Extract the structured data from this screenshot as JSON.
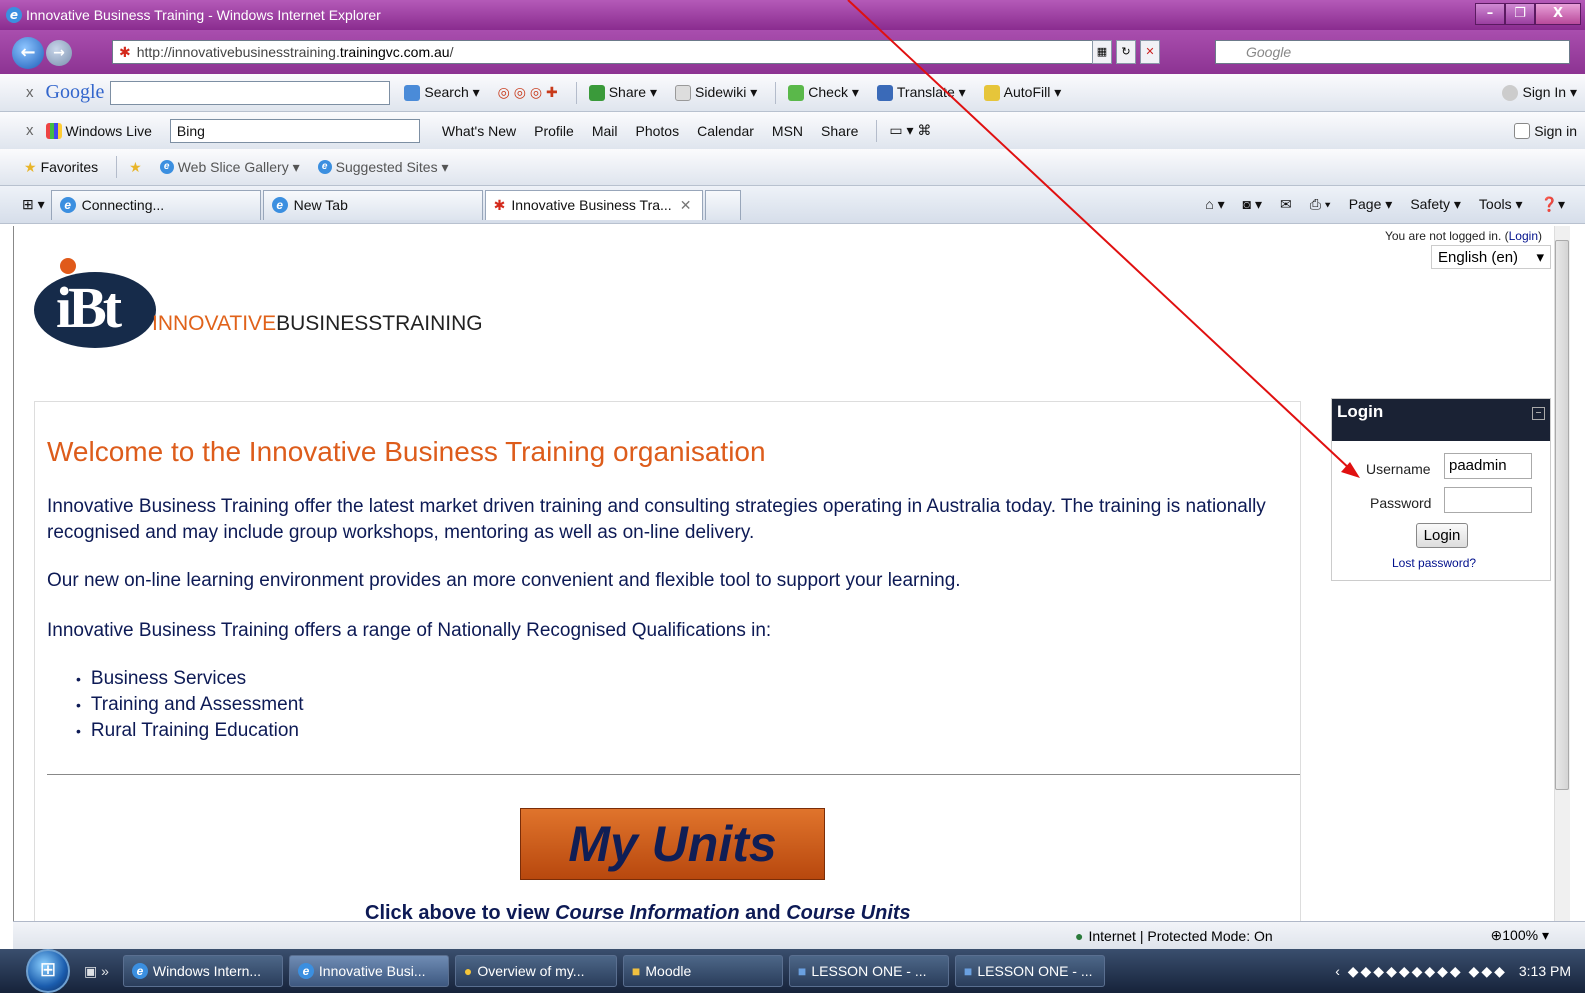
{
  "window": {
    "title": "Innovative Business Training - Windows Internet Explorer",
    "controls": [
      "–",
      "❐",
      "X"
    ]
  },
  "address": {
    "url_prefix": "http://innovativebusinesstraining.",
    "url_domain": "trainingvc.com.au",
    "url_suffix": "/",
    "search_placeholder": "Google"
  },
  "google_toolbar": {
    "logo": "Google",
    "items": [
      "Search ▾",
      "Share ▾",
      "Sidewiki ▾",
      "Check ▾",
      "Translate ▾",
      "AutoFill ▾"
    ],
    "sign_in": "Sign In ▾"
  },
  "live_toolbar": {
    "logo": "Windows Live",
    "search_value": "Bing",
    "items": [
      "What's New",
      "Profile",
      "Mail",
      "Photos",
      "Calendar",
      "MSN",
      "Share"
    ],
    "sign_in": "Sign in"
  },
  "favorites_bar": {
    "favorites": "Favorites",
    "items": [
      "Web Slice Gallery ▾",
      "Suggested Sites ▾"
    ]
  },
  "tabs": [
    {
      "label": "Connecting..."
    },
    {
      "label": "New Tab"
    },
    {
      "label": "Innovative Business Tra...",
      "active": true
    }
  ],
  "command_bar": [
    "Page ▾",
    "Safety ▾",
    "Tools ▾"
  ],
  "page": {
    "login_status_prefix": "You are not logged in. (",
    "login_status_link": "Login",
    "login_status_suffix": ")",
    "language": "English (en)",
    "logo_ibt": "iBt",
    "logo_innovative": "INNOVATIVE",
    "logo_rest": "BUSINESSTRAINING",
    "welcome": "Welcome to the Innovative Business Training organisation",
    "para1": "Innovative Business Training offer the latest market driven training and consulting strategies operating in Australia today. The training is nationally recognised and may include group workshops, mentoring as well as on-line delivery.",
    "para2": "Our new on-line learning environment provides an more convenient and flexible tool to support your learning.",
    "para3": "Innovative Business Training offers a range of Nationally Recognised Qualifications in:",
    "qualifications": [
      "Business Services",
      "Training and Assessment",
      "Rural Training Education"
    ],
    "my_units": "My Units",
    "click_above_prefix": "Click above to view ",
    "click_above_em1": "Course Information",
    "click_above_mid": " and ",
    "click_above_em2": "Course Units"
  },
  "login": {
    "title": "Login",
    "username_label": "Username",
    "username_value": "paadmin",
    "password_label": "Password",
    "button": "Login",
    "lost_password": "Lost password?"
  },
  "statusbar": {
    "zone": "Internet | Protected Mode: On",
    "zoom": "100%"
  },
  "taskbar": {
    "buttons": [
      "Windows Intern...",
      "Innovative Busi...",
      "Overview of my...",
      "Moodle",
      "LESSON ONE - ...",
      "LESSON ONE - ..."
    ],
    "clock": "3:13 PM"
  },
  "colors": {
    "title_bar": "#8a2c8f",
    "accent_orange": "#dd5c1b",
    "text_navy": "#0d1a55",
    "login_header": "#1a2234",
    "annotation_arrow": "#e01010"
  }
}
